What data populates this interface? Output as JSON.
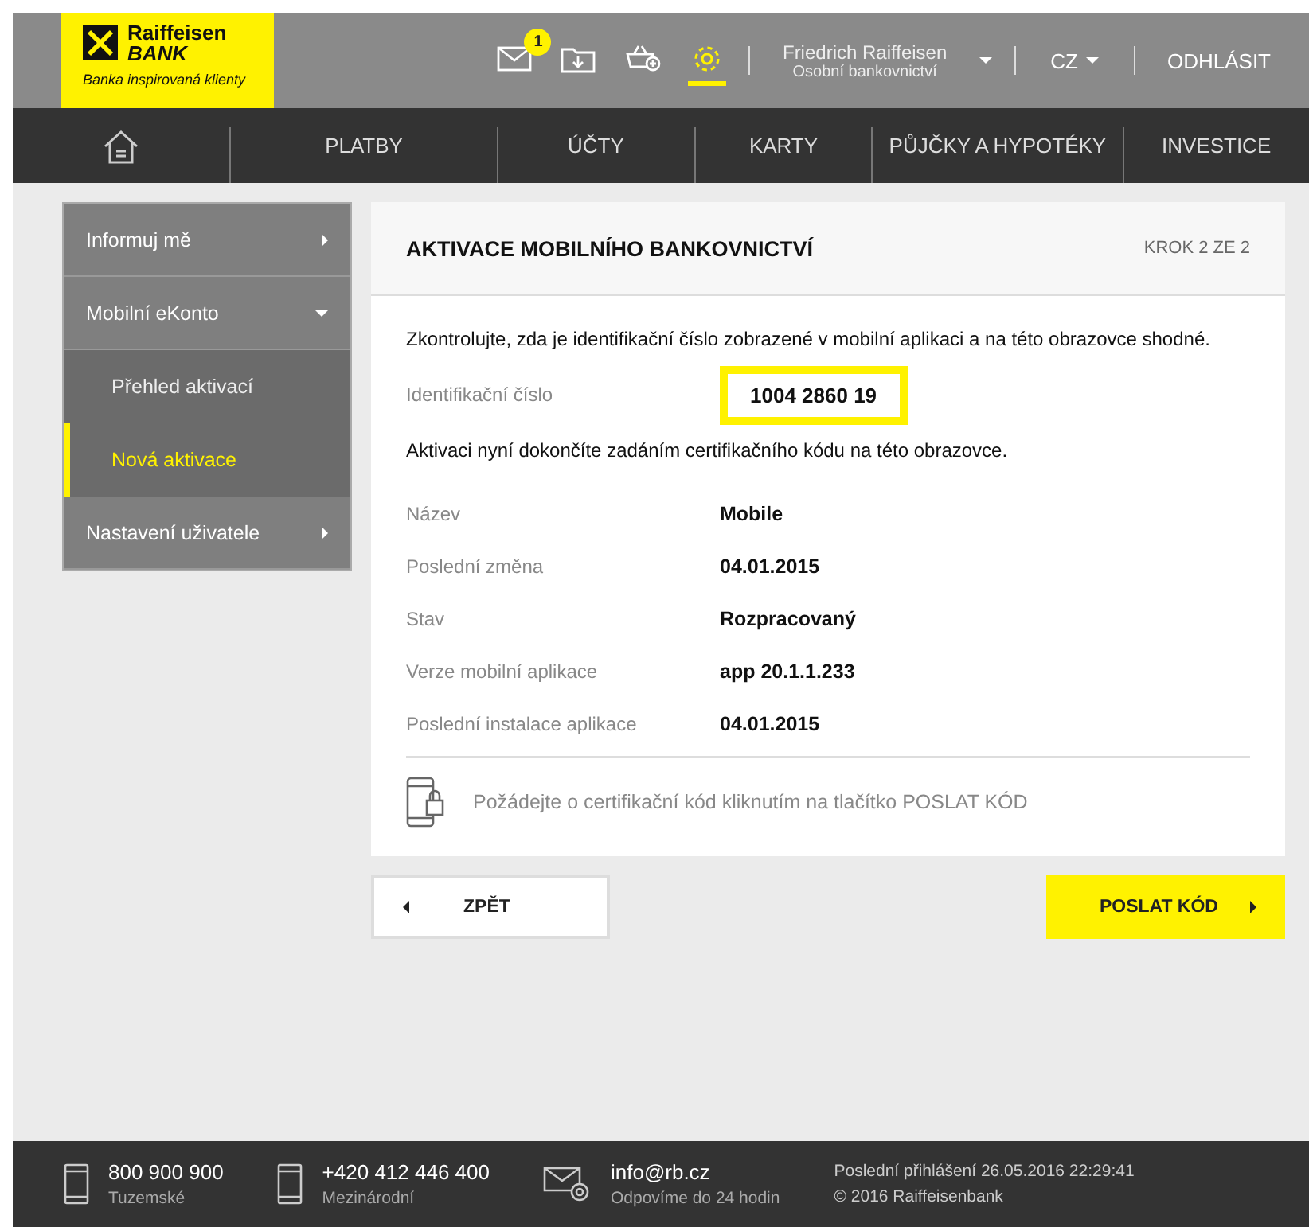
{
  "logo": {
    "name": "Raiffeisen",
    "sub": "BANK",
    "tagline": "Banka inspirovaná klienty"
  },
  "header": {
    "icons": [
      {
        "kind": "mail",
        "badge": "1",
        "selected": false
      },
      {
        "kind": "download",
        "selected": false
      },
      {
        "kind": "basket",
        "selected": false
      },
      {
        "kind": "gear",
        "selected": true
      }
    ],
    "user": {
      "name": "Friedrich Raiffeisen",
      "role": "Osobní bankovnictví"
    },
    "language": "CZ",
    "logout": "ODHLÁSIT"
  },
  "nav": {
    "items": [
      {
        "label": "PLATBY"
      },
      {
        "label": "ÚČTY"
      },
      {
        "label": "KARTY"
      },
      {
        "label": "PŮJČKY A HYPOTÉKY"
      },
      {
        "label": "INVESTICE"
      }
    ]
  },
  "sidebar": {
    "items": [
      {
        "label": "Informuj mě",
        "expanded": false
      },
      {
        "label": "Mobilní eKonto",
        "expanded": true,
        "children": [
          {
            "label": "Přehled aktivací",
            "selected": false
          },
          {
            "label": "Nová aktivace",
            "selected": true
          }
        ]
      },
      {
        "label": "Nastavení uživatele",
        "expanded": false
      }
    ]
  },
  "card": {
    "title": "AKTIVACE MOBILNÍHO BANKOVNICTVÍ",
    "step": "KROK 2 ZE 2",
    "intro": "Zkontrolujte, zda je identifikační číslo zobrazené v mobilní aplikaci a na této obrazovce shodné.",
    "id_label": "Identifikační číslo",
    "id_value": "1004 2860 19",
    "instruction": "Aktivaci nyní dokončíte zadáním certifikačního kódu na této obrazovce.",
    "details": [
      {
        "label": "Název",
        "value": "Mobile"
      },
      {
        "label": "Poslední změna",
        "value": "04.01.2015"
      },
      {
        "label": "Stav",
        "value": "Rozpracovaný"
      },
      {
        "label": "Verze mobilní aplikace",
        "value": "app 20.1.1.233"
      },
      {
        "label": "Poslední instalace aplikace",
        "value": "04.01.2015"
      }
    ],
    "hint": "Požádejte o certifikační kód kliknutím na tlačítko POSLAT KÓD"
  },
  "buttons": {
    "back": "ZPĚT",
    "send": "POSLAT KÓD"
  },
  "footer": {
    "contacts": [
      {
        "kind": "phone",
        "main": "800 900 900",
        "sub": "Tuzemské"
      },
      {
        "kind": "phone",
        "main": "+420 412 446 400",
        "sub": "Mezinárodní"
      },
      {
        "kind": "mail",
        "main": "info@rb.cz",
        "sub": "Odpovíme do 24 hodin"
      }
    ],
    "last_login": "Poslední přihlášení 26.05.2016 22:29:41",
    "copyright": "© 2016 Raiffeisenbank"
  }
}
